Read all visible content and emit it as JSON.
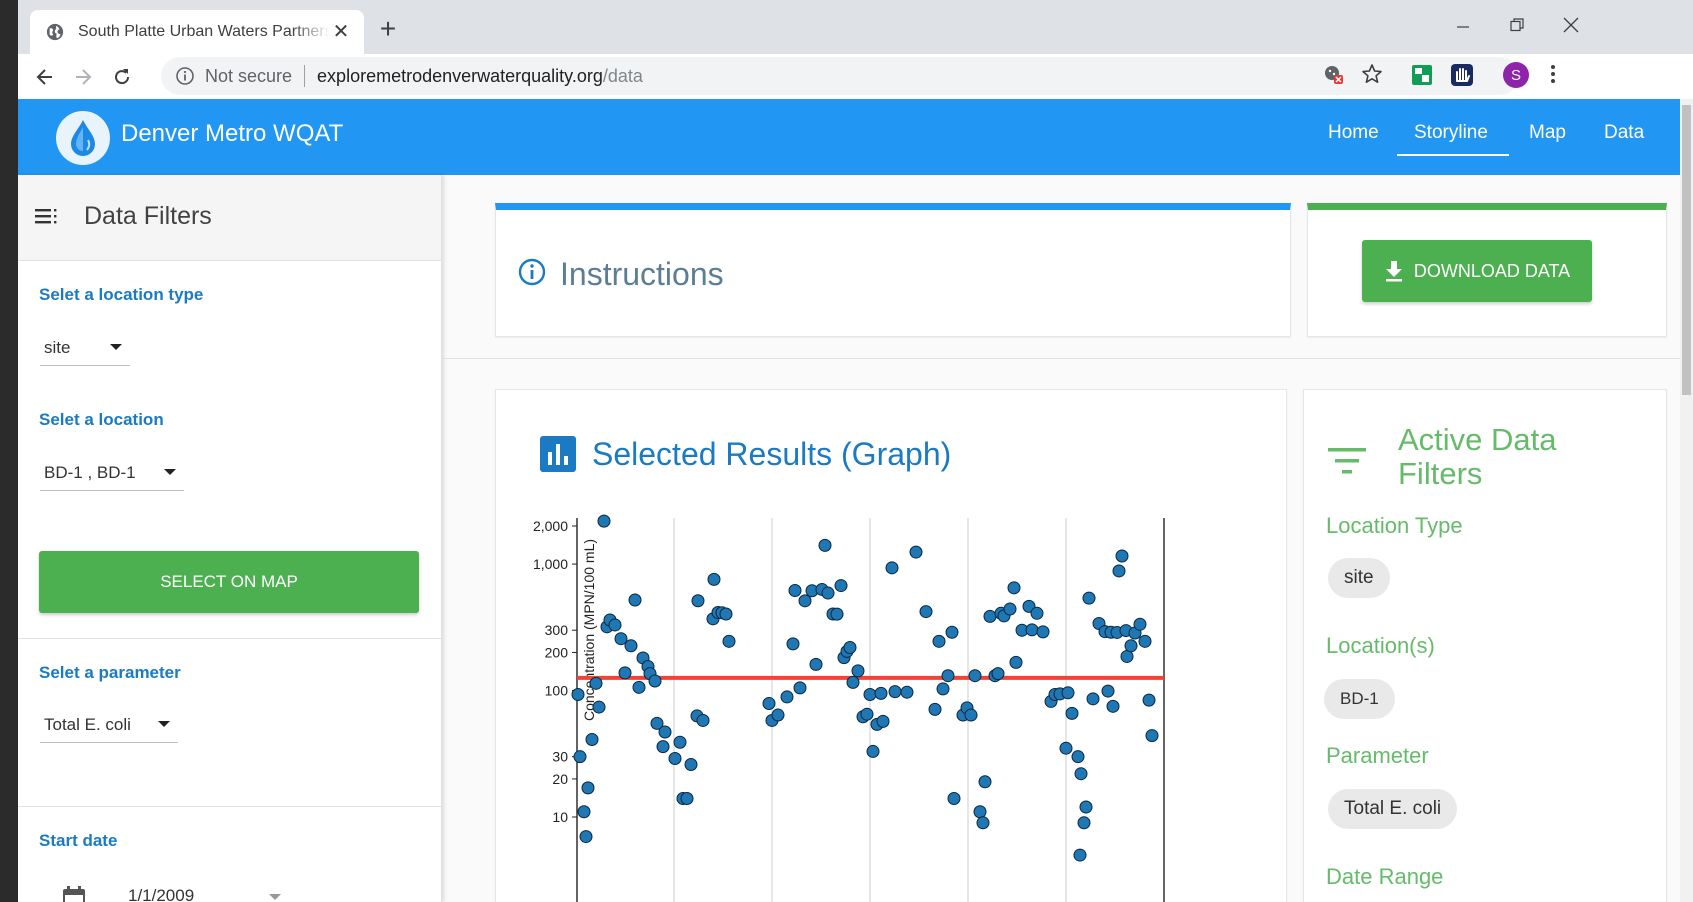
{
  "browser": {
    "tab_title": "South Platte Urban Waters Partnership",
    "security_label": "Not secure",
    "url_host": "exploremetrodenverwaterquality.org",
    "url_path": "/data",
    "profile_initial": "S"
  },
  "app": {
    "brand": "Denver Metro WQAT",
    "nav": [
      "Home",
      "Storyline",
      "Map",
      "Data"
    ],
    "active_nav": "Storyline"
  },
  "sidebar": {
    "title": "Data Filters",
    "location_type_label": "Selet a location type",
    "location_type_value": "site",
    "location_label": "Selet a location",
    "location_value": "BD-1 , BD-1",
    "select_on_map": "SELECT ON MAP",
    "parameter_label": "Selet a parameter",
    "parameter_value": "Total E. coli",
    "start_date_label": "Start date",
    "start_date_value": "1/1/2009"
  },
  "main": {
    "instructions_title": "Instructions",
    "download_label": "DOWNLOAD DATA",
    "graph_title": "Selected Results (Graph)"
  },
  "active_filters": {
    "title": "Active Data Filters",
    "location_type_label": "Location Type",
    "location_type_chip": "site",
    "locations_label": "Location(s)",
    "locations_chip": "BD-1",
    "parameter_label": "Parameter",
    "parameter_chip": "Total E. coli",
    "date_range_label": "Date Range"
  },
  "colors": {
    "appbar": "#2196f3",
    "accent_green": "#4caf50",
    "point_fill": "#1f77b4",
    "threshold_line": "#f44336"
  },
  "chart_data": {
    "type": "scatter",
    "ylabel": "Concentration (MPN/100 mL)",
    "yscale": "log",
    "yticks": [
      10,
      20,
      30,
      100,
      200,
      300,
      1000,
      2000
    ],
    "ytick_labels": [
      "10",
      "20",
      "30",
      "100",
      "200",
      "300",
      "1,000",
      "2,000"
    ],
    "ylim": [
      6,
      2500
    ],
    "xlim": [
      0,
      595
    ],
    "vgrid": [
      97,
      195,
      293,
      391,
      489,
      587
    ],
    "threshold": 126,
    "points": [
      [
        1,
        93
      ],
      [
        3,
        30
      ],
      [
        7,
        11
      ],
      [
        9,
        7
      ],
      [
        11,
        17
      ],
      [
        15,
        41
      ],
      [
        19,
        114
      ],
      [
        22,
        74
      ],
      [
        27,
        2185
      ],
      [
        30,
        319
      ],
      [
        33,
        361
      ],
      [
        38,
        330
      ],
      [
        44,
        257
      ],
      [
        48,
        138
      ],
      [
        54,
        226
      ],
      [
        58,
        520
      ],
      [
        62,
        106
      ],
      [
        66,
        181
      ],
      [
        71,
        155
      ],
      [
        73,
        136
      ],
      [
        78,
        119
      ],
      [
        80,
        55
      ],
      [
        86,
        36
      ],
      [
        88,
        47
      ],
      [
        98,
        29
      ],
      [
        103,
        39
      ],
      [
        106,
        14
      ],
      [
        110,
        14
      ],
      [
        114,
        26
      ],
      [
        120,
        63
      ],
      [
        121,
        513
      ],
      [
        126,
        58
      ],
      [
        136,
        369
      ],
      [
        137,
        757
      ],
      [
        141,
        414
      ],
      [
        145,
        412
      ],
      [
        149,
        403
      ],
      [
        152,
        245
      ],
      [
        192,
        79
      ],
      [
        195,
        58
      ],
      [
        201,
        64
      ],
      [
        210,
        89
      ],
      [
        216,
        234
      ],
      [
        218,
        618
      ],
      [
        223,
        105
      ],
      [
        228,
        512
      ],
      [
        235,
        615
      ],
      [
        239,
        161
      ],
      [
        245,
        630
      ],
      [
        248,
        1405
      ],
      [
        251,
        590
      ],
      [
        256,
        403
      ],
      [
        260,
        402
      ],
      [
        264,
        676
      ],
      [
        267,
        182
      ],
      [
        270,
        204
      ],
      [
        273,
        219
      ],
      [
        276,
        116
      ],
      [
        281,
        143
      ],
      [
        286,
        62
      ],
      [
        290,
        65
      ],
      [
        293,
        93
      ],
      [
        296,
        33
      ],
      [
        300,
        54
      ],
      [
        304,
        95
      ],
      [
        306,
        57
      ],
      [
        315,
        934
      ],
      [
        318,
        98
      ],
      [
        330,
        97
      ],
      [
        339,
        1244
      ],
      [
        349,
        421
      ],
      [
        358,
        71
      ],
      [
        362,
        245
      ],
      [
        366,
        103
      ],
      [
        371,
        131
      ],
      [
        375,
        289
      ],
      [
        377,
        14
      ],
      [
        386,
        64
      ],
      [
        390,
        73
      ],
      [
        394,
        64
      ],
      [
        398,
        131
      ],
      [
        403,
        11
      ],
      [
        406,
        9
      ],
      [
        408,
        19
      ],
      [
        413,
        386
      ],
      [
        418,
        131
      ],
      [
        421,
        136
      ],
      [
        424,
        408
      ],
      [
        427,
        389
      ],
      [
        433,
        441
      ],
      [
        437,
        649
      ],
      [
        439,
        167
      ],
      [
        445,
        300
      ],
      [
        452,
        463
      ],
      [
        455,
        302
      ],
      [
        460,
        408
      ],
      [
        466,
        291
      ],
      [
        474,
        82
      ],
      [
        478,
        93
      ],
      [
        483,
        94
      ],
      [
        489,
        35
      ],
      [
        491,
        96
      ],
      [
        495,
        66
      ],
      [
        501,
        30
      ],
      [
        503,
        5
      ],
      [
        504,
        22
      ],
      [
        507,
        9
      ],
      [
        509,
        12
      ],
      [
        512,
        538
      ],
      [
        516,
        86
      ],
      [
        522,
        339
      ],
      [
        528,
        292
      ],
      [
        531,
        99
      ],
      [
        534,
        289
      ],
      [
        536,
        75
      ],
      [
        540,
        288
      ],
      [
        542,
        882
      ],
      [
        545,
        1158
      ],
      [
        549,
        298
      ],
      [
        550,
        186
      ],
      [
        554,
        226
      ],
      [
        558,
        285
      ],
      [
        563,
        334
      ],
      [
        568,
        245
      ],
      [
        572,
        84
      ],
      [
        575,
        44
      ]
    ]
  }
}
